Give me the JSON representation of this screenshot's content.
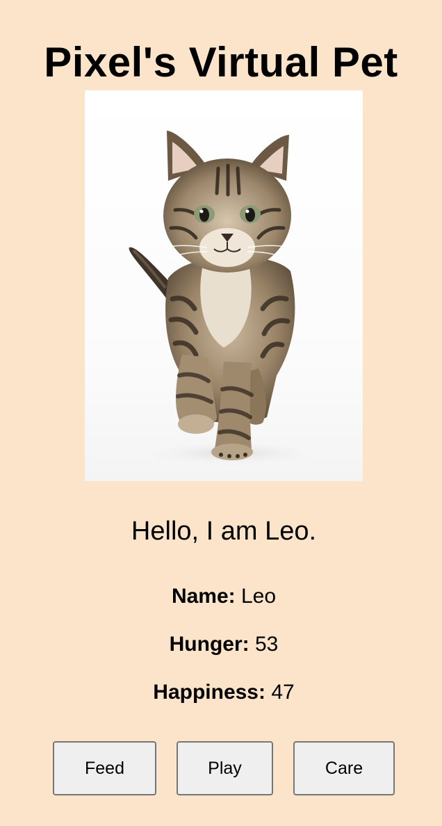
{
  "page": {
    "title": "Pixel's Virtual Pet"
  },
  "pet": {
    "image_subject": "tabby kitten",
    "greeting": "Hello, I am Leo.",
    "stats": [
      {
        "label": "Name:",
        "value": "Leo"
      },
      {
        "label": "Hunger:",
        "value": "53"
      },
      {
        "label": "Happiness:",
        "value": "47"
      }
    ]
  },
  "actions": {
    "feed_label": "Feed",
    "play_label": "Play",
    "care_label": "Care"
  },
  "colors": {
    "background": "#fbe4c9",
    "button_bg": "#efefef",
    "button_border": "#767676"
  }
}
